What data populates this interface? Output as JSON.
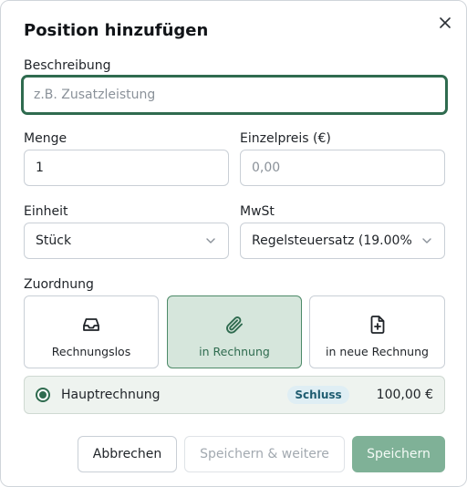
{
  "dialog": {
    "title": "Position hinzufügen"
  },
  "fields": {
    "description": {
      "label": "Beschreibung",
      "value": "",
      "placeholder": "z.B. Zusatzleistung"
    },
    "quantity": {
      "label": "Menge",
      "value": "1",
      "placeholder": ""
    },
    "unit_price": {
      "label": "Einzelpreis (€)",
      "value": "",
      "placeholder": "0,00"
    },
    "unit": {
      "label": "Einheit",
      "value": "Stück"
    },
    "vat": {
      "label": "MwSt",
      "value": "Regelsteuersatz (19.00%"
    }
  },
  "assignment": {
    "label": "Zuordnung",
    "options": [
      {
        "label": "Rechnungslos",
        "icon": "inbox-icon",
        "selected": false
      },
      {
        "label": "in Rechnung",
        "icon": "paperclip-icon",
        "selected": true
      },
      {
        "label": "in neue Rechnung",
        "icon": "file-plus-icon",
        "selected": false
      }
    ],
    "invoice": {
      "name": "Hauptrechnung",
      "badge": "Schluss",
      "amount": "100,00 €",
      "selected": true
    }
  },
  "buttons": {
    "cancel": "Abbrechen",
    "save_more": "Speichern & weitere",
    "save": "Speichern"
  },
  "colors": {
    "accent": "#2f6b4f",
    "primary_button": "#7fb197",
    "active_card": "#d6e6dc",
    "badge_bg": "#dfeef4",
    "badge_text": "#1e5c70"
  }
}
